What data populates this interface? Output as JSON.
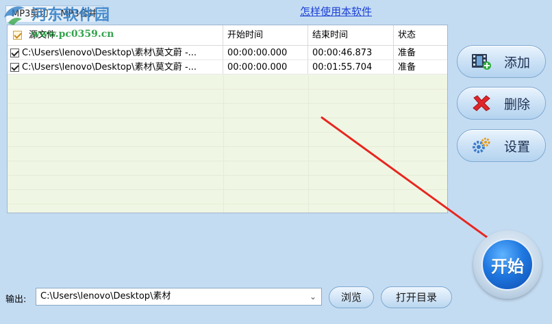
{
  "tabs": [
    "MP3剪切",
    "MP3合并"
  ],
  "watermark": {
    "title": "河东软件园",
    "url": "www.pc0359.cn"
  },
  "help_link": "怎样使用本软件",
  "table": {
    "columns": [
      "源文件",
      "开始时间",
      "结束时间",
      "状态"
    ],
    "rows": [
      {
        "checked": true,
        "file": "C:\\Users\\lenovo\\Desktop\\素材\\莫文蔚 -...",
        "start": "00:00:00.000",
        "end": "00:00:46.873",
        "status": "准备"
      },
      {
        "checked": true,
        "file": "C:\\Users\\lenovo\\Desktop\\素材\\莫文蔚 -...",
        "start": "00:00:00.000",
        "end": "00:01:55.704",
        "status": "准备"
      }
    ]
  },
  "buttons": {
    "add": "添加",
    "delete": "删除",
    "settings": "设置",
    "start": "开始"
  },
  "output": {
    "label": "输出:",
    "path": "C:\\Users\\lenovo\\Desktop\\素材",
    "browse": "浏览",
    "open_dir": "打开目录"
  },
  "colors": {
    "background": "#c4dcf2",
    "link": "#1b3fd6",
    "arrow": "#e8261f",
    "start": "#1f78e0"
  },
  "icons": {
    "add": "film-add-icon",
    "delete": "red-x-icon",
    "settings": "gears-icon",
    "dropdown": "chevron-down-icon"
  }
}
